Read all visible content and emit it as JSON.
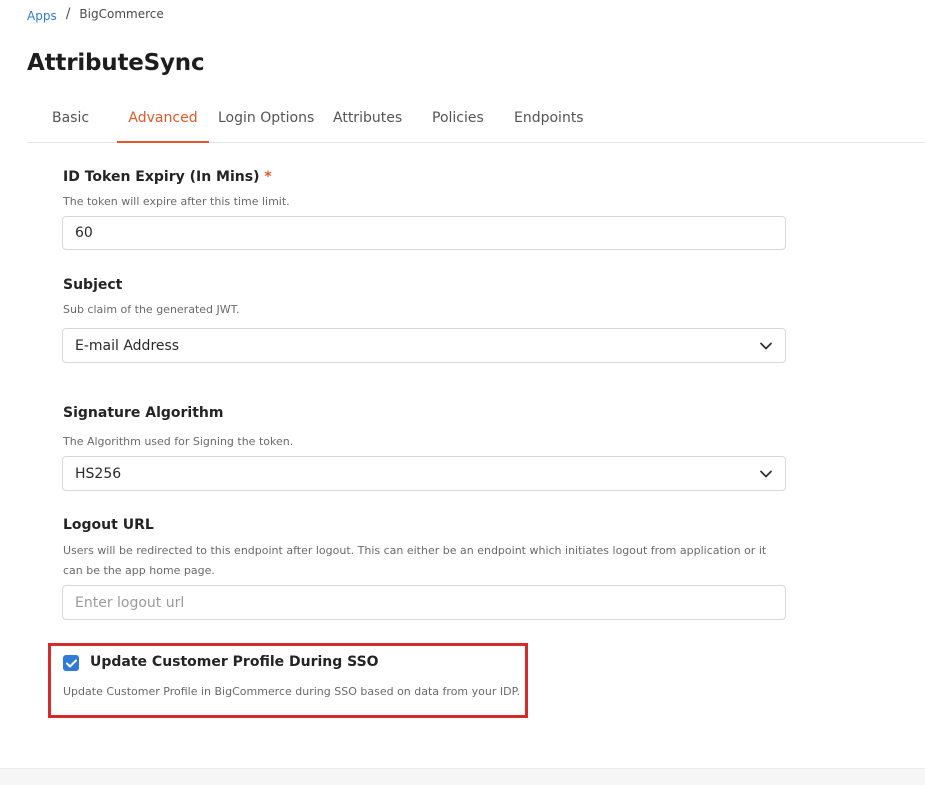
{
  "breadcrumb": {
    "parent": "Apps",
    "separator": "/",
    "current": "BigCommerce"
  },
  "page": {
    "title": "AttributeSync"
  },
  "tabs": [
    {
      "label": "Basic",
      "active": false
    },
    {
      "label": "Advanced",
      "active": true
    },
    {
      "label": "Login Options",
      "active": false
    },
    {
      "label": "Attributes",
      "active": false
    },
    {
      "label": "Policies",
      "active": false
    },
    {
      "label": "Endpoints",
      "active": false
    }
  ],
  "token_expiry": {
    "label": "ID Token Expiry (In Mins)",
    "required_mark": "*",
    "help": "The token will expire after this time limit.",
    "value": "60"
  },
  "subject": {
    "label": "Subject",
    "help": "Sub claim of the generated JWT.",
    "selected": "E-mail Address"
  },
  "signature": {
    "label": "Signature Algorithm",
    "help": "The Algorithm used for Signing the token.",
    "selected": "HS256"
  },
  "logout": {
    "label": "Logout URL",
    "help_line1": "Users will be redirected to this endpoint after logout. This can either be an endpoint which initiates logout from application or it",
    "help_line2": "can be the app home page.",
    "value": "",
    "placeholder": "Enter logout url"
  },
  "update_profile": {
    "label": "Update Customer Profile During SSO",
    "checked": true,
    "help": "Update Customer Profile in BigCommerce during SSO based on data from your IDP."
  },
  "colors": {
    "accent": "#e0582a",
    "link": "#2f7bd8",
    "highlight_border": "#d42b2b"
  },
  "icons": {
    "select_arrow": "chevron-down-icon",
    "checkbox": "checkmark-icon"
  }
}
